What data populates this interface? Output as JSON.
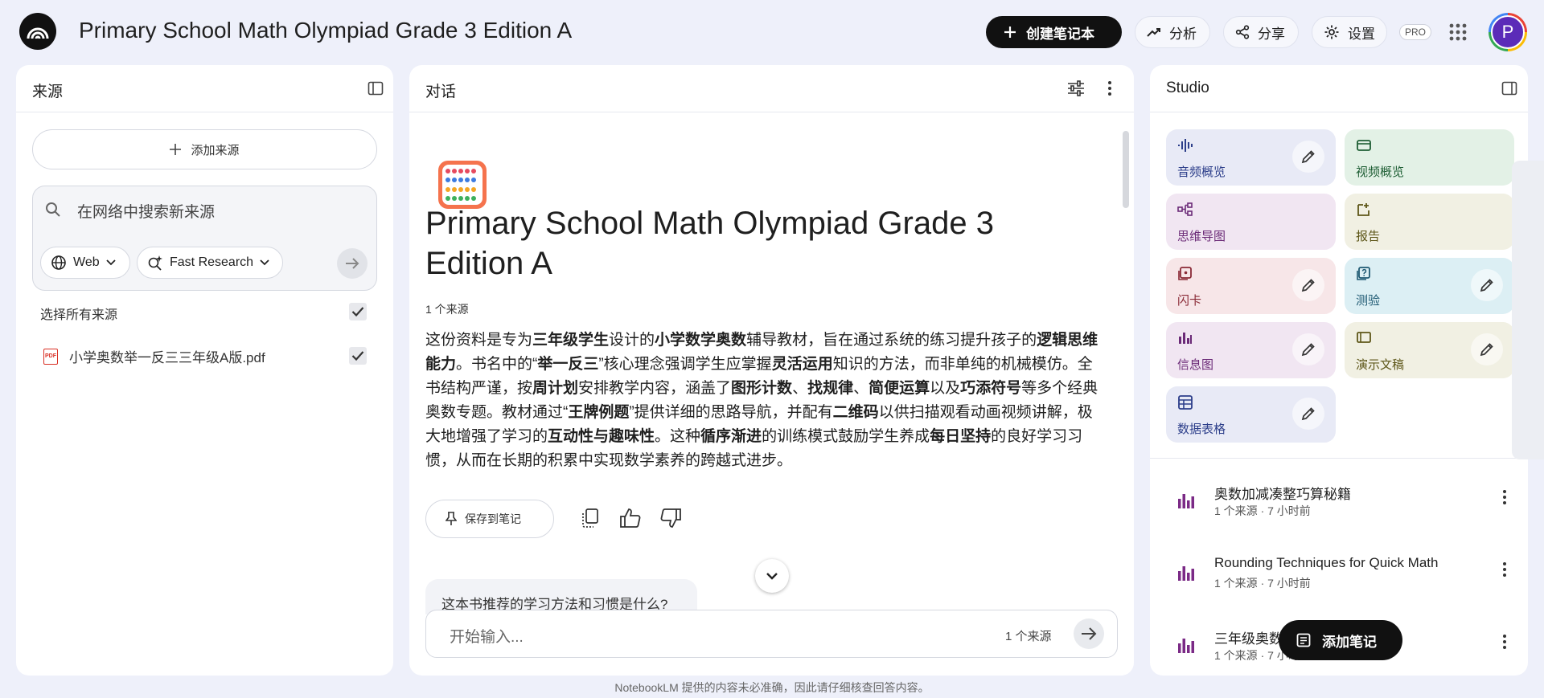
{
  "header": {
    "title": "Primary School Math Olympiad Grade 3 Edition A",
    "create_label": "创建笔记本",
    "analytics_label": "分析",
    "share_label": "分享",
    "settings_label": "设置",
    "pro_label": "PRO",
    "avatar_letter": "P"
  },
  "sources": {
    "title": "来源",
    "add_label": "添加来源",
    "search_placeholder": "在网络中搜索新来源",
    "web_chip": "Web",
    "research_chip": "Fast Research",
    "select_all": "选择所有来源",
    "items": [
      {
        "name": "小学奥数举一反三三年级A版.pdf",
        "checked": true
      }
    ]
  },
  "chat": {
    "title": "对话",
    "doc_title": "Primary School Math Olympiad Grade 3 Edition A",
    "source_count": "1 个来源",
    "summary": [
      {
        "t": "这份资料是专为",
        "b": false
      },
      {
        "t": "三年级学生",
        "b": true
      },
      {
        "t": "设计的",
        "b": false
      },
      {
        "t": "小学数学奥数",
        "b": true
      },
      {
        "t": "辅导教材，旨在通过系统的练习提升孩子的",
        "b": false
      },
      {
        "t": "逻辑思维能力",
        "b": true
      },
      {
        "t": "。书名中的“",
        "b": false
      },
      {
        "t": "举一反三",
        "b": true
      },
      {
        "t": "”核心理念强调学生应掌握",
        "b": false
      },
      {
        "t": "灵活运用",
        "b": true
      },
      {
        "t": "知识的方法，而非单纯的机械模仿。全书结构严谨，按",
        "b": false
      },
      {
        "t": "周计划",
        "b": true
      },
      {
        "t": "安排教学内容，涵盖了",
        "b": false
      },
      {
        "t": "图形计数",
        "b": true
      },
      {
        "t": "、",
        "b": false
      },
      {
        "t": "找规律",
        "b": true
      },
      {
        "t": "、",
        "b": false
      },
      {
        "t": "简便运算",
        "b": true
      },
      {
        "t": "以及",
        "b": false
      },
      {
        "t": "巧添符号",
        "b": true
      },
      {
        "t": "等多个经典奥数专题。教材通过“",
        "b": false
      },
      {
        "t": "王牌例题",
        "b": true
      },
      {
        "t": "”提供详细的思路导航，并配有",
        "b": false
      },
      {
        "t": "二维码",
        "b": true
      },
      {
        "t": "以供扫描观看动画视频讲解，极大地增强了学习的",
        "b": false
      },
      {
        "t": "互动性与趣味性",
        "b": true
      },
      {
        "t": "。这种",
        "b": false
      },
      {
        "t": "循序渐进",
        "b": true
      },
      {
        "t": "的训练模式鼓励学生养成",
        "b": false
      },
      {
        "t": "每日坚持",
        "b": true
      },
      {
        "t": "的良好学习习惯，从而在长期的积累中实现数学素养的跨越式进步。",
        "b": false
      }
    ],
    "save_label": "保存到笔记",
    "suggestion": "这本书推荐的学习方法和习惯是什么?",
    "input_placeholder": "开始输入...",
    "input_source_count": "1 个来源"
  },
  "studio": {
    "title": "Studio",
    "tiles": [
      {
        "label": "音频概览",
        "icon": "audio-wave-icon",
        "bg": "#e8eaf6",
        "fg": "#2c3e8a",
        "edit": true
      },
      {
        "label": "视频概览",
        "icon": "video-icon",
        "bg": "#e3f1e6",
        "fg": "#1e5e34",
        "edit": false
      },
      {
        "label": "思维导图",
        "icon": "mind-map-icon",
        "bg": "#f1e6f2",
        "fg": "#6b2a77",
        "edit": false
      },
      {
        "label": "报告",
        "icon": "report-icon",
        "bg": "#f1f0e3",
        "fg": "#5d5618",
        "edit": false
      },
      {
        "label": "闪卡",
        "icon": "flashcard-icon",
        "bg": "#f7e6e8",
        "fg": "#8a2a36",
        "edit": true
      },
      {
        "label": "测验",
        "icon": "quiz-icon",
        "bg": "#dceff4",
        "fg": "#1f5a73",
        "edit": true
      },
      {
        "label": "信息图",
        "icon": "infographic-icon",
        "bg": "#f1e6f2",
        "fg": "#6b2a77",
        "edit": true
      },
      {
        "label": "演示文稿",
        "icon": "slides-icon",
        "bg": "#f1f0e3",
        "fg": "#5d5618",
        "edit": true
      },
      {
        "label": "数据表格",
        "icon": "table-icon",
        "bg": "#e8eaf6",
        "fg": "#2c3e8a",
        "edit": true
      }
    ],
    "notes": [
      {
        "title": "奥数加减凑整巧算秘籍",
        "meta": "1 个来源 · 7 小时前"
      },
      {
        "title": "Rounding Techniques for Quick Math",
        "meta": "1 个来源 · 7 小时前"
      },
      {
        "title": "三年级奥数",
        "meta": "1 个来源 · 7 小时前"
      }
    ],
    "add_note_label": "添加笔记"
  },
  "footer": "NotebookLM 提供的内容未必准确，因此请仔细核查回答内容。",
  "colors": {
    "accent_dark": "#111111",
    "note_icon": "#7b2a86",
    "background": "#eef0fa"
  }
}
